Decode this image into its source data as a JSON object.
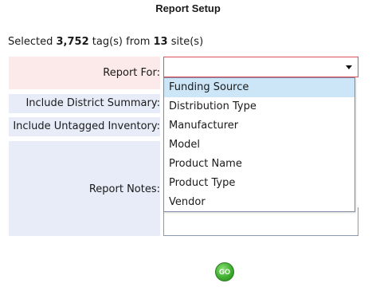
{
  "header": {
    "title": "Report Setup"
  },
  "summary": {
    "prefix": "Selected ",
    "tag_count": "3,752",
    "middle": " tag(s) from ",
    "site_count": "13",
    "suffix": " site(s)"
  },
  "form": {
    "report_for_label": "Report For:",
    "report_for_value": "",
    "district_label": "Include District Summary:",
    "untagged_label": "Include Untagged Inventory:",
    "notes_label": "Report Notes:",
    "notes_value": ""
  },
  "dropdown": {
    "options": [
      "Funding Source",
      "Distribution Type",
      "Manufacturer",
      "Model",
      "Product Name",
      "Product Type",
      "Vendor"
    ],
    "highlighted_index": 0
  },
  "actions": {
    "go_label": "GO",
    "go_color": "#3fae2e"
  },
  "colors": {
    "error_row": "#fce9ea",
    "row_bg": "#e8ecf9",
    "error_border": "#e0505a",
    "highlight": "#cde6f7"
  }
}
